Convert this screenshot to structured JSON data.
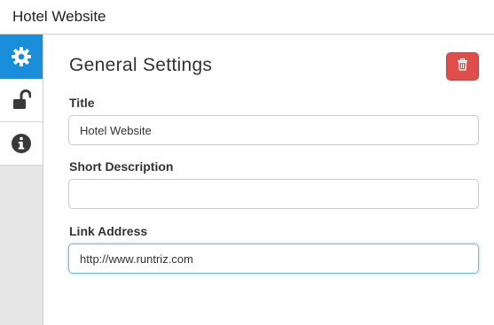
{
  "header": {
    "title": "Hotel Website"
  },
  "sidebar": {
    "items": [
      {
        "icon": "gear-icon",
        "active": true
      },
      {
        "icon": "unlock-icon",
        "active": false
      },
      {
        "icon": "info-icon",
        "active": false
      }
    ]
  },
  "panel": {
    "title": "General Settings",
    "delete_icon": "trash-icon"
  },
  "form": {
    "title_label": "Title",
    "title_value": "Hotel Website",
    "description_label": "Short Description",
    "description_value": "",
    "link_label": "Link Address",
    "link_value": "http://www.runtriz.com"
  },
  "colors": {
    "accent": "#1a8ed8",
    "danger": "#de4f4b",
    "focus_border": "#7ab4e0"
  }
}
